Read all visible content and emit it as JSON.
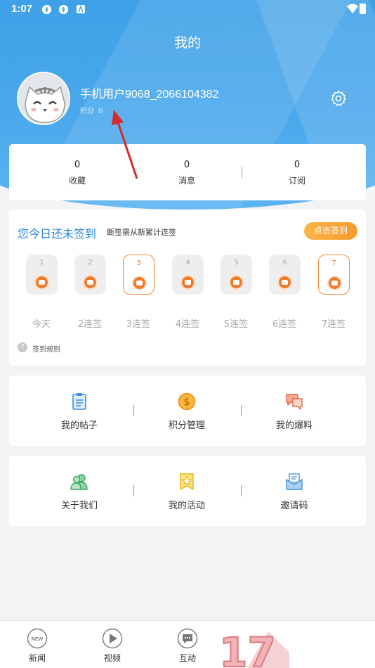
{
  "status_bar": {
    "time": "1:07"
  },
  "header": {
    "title": "我的"
  },
  "profile": {
    "username": "手机用户9068_2066104382",
    "points_label": "积分",
    "points_value": "0"
  },
  "stats": [
    {
      "value": "0",
      "label": "收藏"
    },
    {
      "value": "0",
      "label": "消息"
    },
    {
      "value": "0",
      "label": "订阅"
    }
  ],
  "signin": {
    "title": "您今日还未签到",
    "subtitle": "断签需从新累计连签",
    "button": "点击签到",
    "days": [
      {
        "num": "1",
        "label": "今天",
        "highlighted": false
      },
      {
        "num": "2",
        "label": "2连签",
        "highlighted": false
      },
      {
        "num": "3",
        "label": "3连签",
        "highlighted": true
      },
      {
        "num": "4",
        "label": "4连签",
        "highlighted": false
      },
      {
        "num": "5",
        "label": "5连签",
        "highlighted": false
      },
      {
        "num": "6",
        "label": "6连签",
        "highlighted": false
      },
      {
        "num": "7",
        "label": "7连签",
        "highlighted": true
      }
    ],
    "rules_icon": "?",
    "rules_label": "签到规则"
  },
  "menu_row1": [
    {
      "label": "我的帖子",
      "icon": "clipboard-icon"
    },
    {
      "label": "积分管理",
      "icon": "coin-dollar-icon"
    },
    {
      "label": "我的爆料",
      "icon": "chat-bubbles-icon"
    }
  ],
  "menu_row2": [
    {
      "label": "关于我们",
      "icon": "users-icon"
    },
    {
      "label": "我的活动",
      "icon": "star-bookmark-icon"
    },
    {
      "label": "邀请码",
      "icon": "envelope-icon"
    }
  ],
  "bottom_nav": [
    {
      "label": "新闻",
      "icon": "new-badge-icon",
      "badge_text": "NEW"
    },
    {
      "label": "视频",
      "icon": "play-icon"
    },
    {
      "label": "互动",
      "icon": "chat-icon"
    }
  ],
  "watermark": "17",
  "colors": {
    "header_blue": "#3b9fe6",
    "accent_orange": "#f79a2e",
    "title_blue": "#2c86d9",
    "arrow_red": "#d42a2a"
  }
}
